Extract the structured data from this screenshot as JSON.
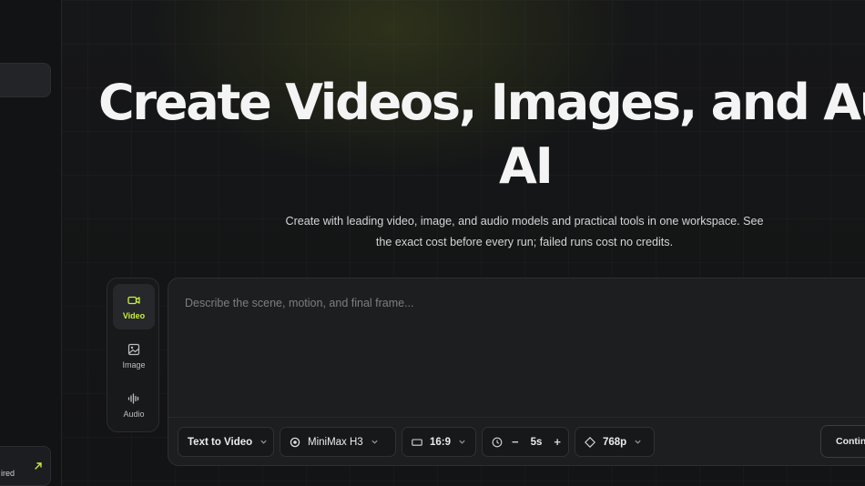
{
  "sidebar": {
    "card_text": "ired"
  },
  "hero": {
    "title_line1": "Create Videos, Images, and Audio with",
    "title_line2": "AI",
    "subtitle_line1": "Create with leading video, image, and audio models and practical tools in one workspace. See",
    "subtitle_line2": "the exact cost before every run; failed runs cost no credits."
  },
  "modes": [
    {
      "label": "Video",
      "icon": "video-icon",
      "active": true
    },
    {
      "label": "Image",
      "icon": "image-icon",
      "active": false
    },
    {
      "label": "Audio",
      "icon": "audio-wave-icon",
      "active": false
    }
  ],
  "composer": {
    "placeholder": "Describe the scene, motion, and final frame...",
    "task_type": "Text to Video",
    "model": "MiniMax H3",
    "aspect_ratio": "16:9",
    "duration_minus": "−",
    "duration": "5s",
    "duration_plus": "+",
    "resolution": "768p",
    "continue_label": "Continue"
  },
  "colors": {
    "accent": "#c8f03c",
    "background": "#141516",
    "panel": "#1d1e20"
  }
}
